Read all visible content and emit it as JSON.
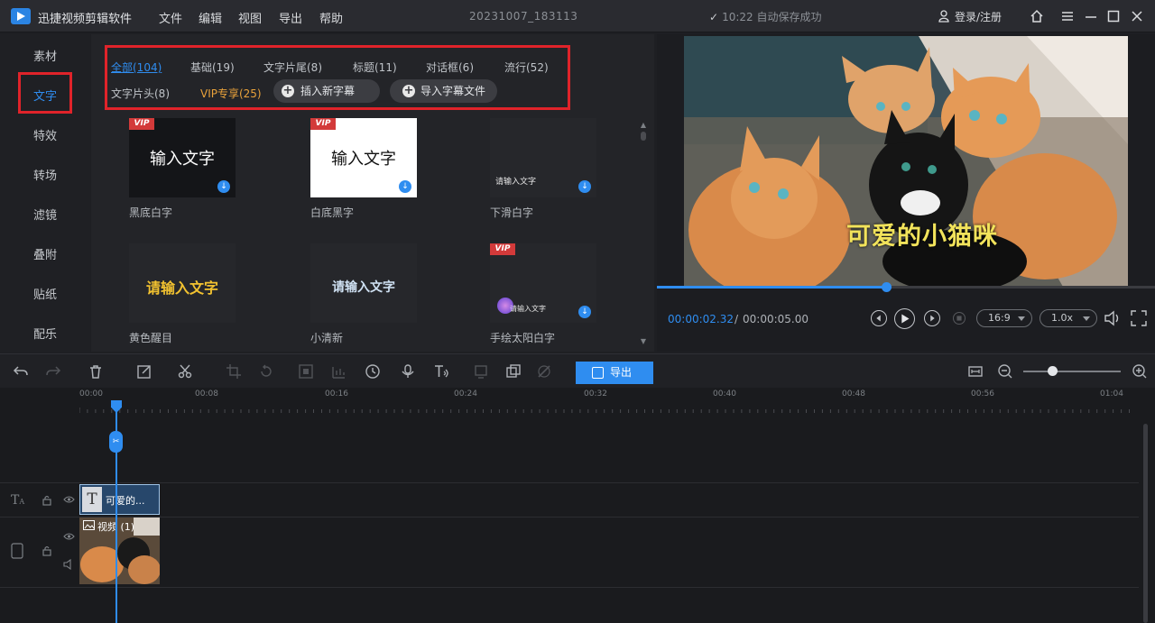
{
  "app": {
    "name": "迅捷视频剪辑软件",
    "project": "20231007_183113",
    "autosave": "10:22 自动保存成功",
    "login": "登录/注册"
  },
  "menu": [
    "文件",
    "编辑",
    "视图",
    "导出",
    "帮助"
  ],
  "sidebar": {
    "active_index": 1,
    "items": [
      {
        "label": "素材"
      },
      {
        "label": "文字"
      },
      {
        "label": "特效"
      },
      {
        "label": "转场"
      },
      {
        "label": "滤镜"
      },
      {
        "label": "叠附"
      },
      {
        "label": "贴纸"
      },
      {
        "label": "配乐"
      }
    ]
  },
  "filters": {
    "row1": [
      {
        "label": "全部(104)",
        "active": true
      },
      {
        "label": "基础(19)"
      },
      {
        "label": "文字片尾(8)"
      },
      {
        "label": "标题(11)"
      },
      {
        "label": "对话框(6)"
      },
      {
        "label": "流行(52)"
      }
    ],
    "row2": [
      {
        "label": "文字片头(8)"
      },
      {
        "label": "VIP专享(25)",
        "vip": true
      }
    ],
    "insert_subtitle": "插入新字幕",
    "import_subtitle": "导入字幕文件"
  },
  "templates": [
    {
      "preview": "输入文字",
      "name": "黑底白字",
      "vip": true,
      "style": "black"
    },
    {
      "preview": "输入文字",
      "name": "白底黑字",
      "vip": true,
      "style": "white"
    },
    {
      "preview": "请输入文字",
      "name": "下滑白字",
      "vip": false,
      "style": "small"
    },
    {
      "preview": "请输入文字",
      "name": "黄色醒目",
      "vip": false,
      "style": "yellow"
    },
    {
      "preview": "请输入文字",
      "name": "小清新",
      "vip": false,
      "style": "fresh"
    },
    {
      "preview": "请输入文字",
      "name": "手绘太阳白字",
      "vip": true,
      "style": "sun"
    }
  ],
  "vip_badge": "VIP",
  "preview": {
    "subtitle": "可爱的小猫咪",
    "current_time": "00:00:02.32",
    "separator": "/",
    "total_time": "00:00:05.00",
    "progress": 0.46,
    "aspect": "16:9",
    "speed": "1.0x"
  },
  "toolbar": {
    "export_label": "导出",
    "zoom_level": 0.3
  },
  "timeline": {
    "ticks": [
      "00:00",
      "00:08",
      "00:16",
      "00:24",
      "00:32",
      "00:40",
      "00:48",
      "00:56",
      "01:04"
    ],
    "text_clip_label": "可爱的...",
    "video_clip_label": "视频 (1)"
  }
}
